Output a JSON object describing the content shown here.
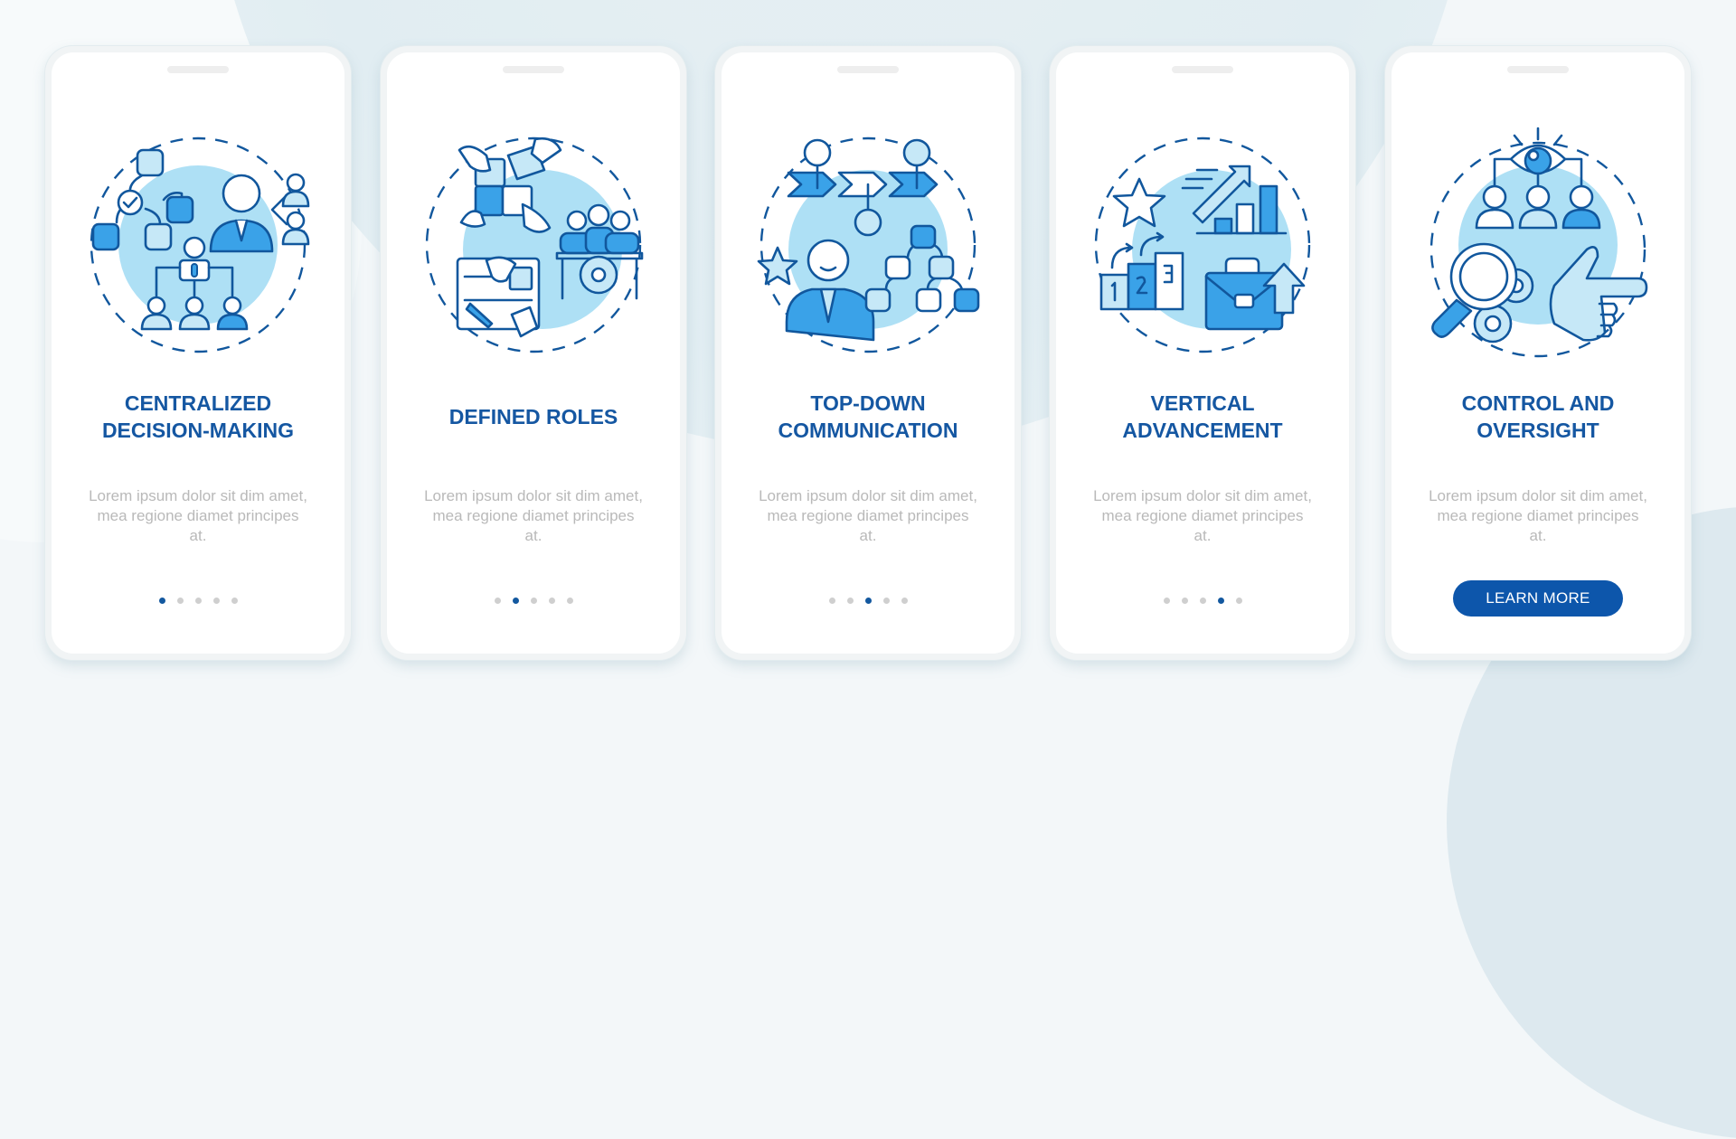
{
  "colors": {
    "background": "#f3f7f9",
    "title": "#1557a2",
    "body_text": "#b9b9b9",
    "dot_active": "#13589f",
    "dot_inactive": "#cfcfcf",
    "button_bg": "#0d56ab",
    "icon_outline": "#11579d",
    "icon_mid_fill": "#3aa2e8",
    "icon_light_fill": "#c6e8f7",
    "icon_bg_circle": "#aee0f5"
  },
  "screens": [
    {
      "icon": "centralized-decision-making-icon",
      "title_lines": [
        "CENTRALIZED",
        "DECISION-MAKING"
      ],
      "body": "Lorem ipsum dolor sit dim amet, mea regione diamet principes at.",
      "page_index": 1,
      "page_count": 5
    },
    {
      "icon": "defined-roles-icon",
      "title_lines": [
        "DEFINED ROLES"
      ],
      "body": "Lorem ipsum dolor sit dim amet, mea regione diamet principes at.",
      "page_index": 2,
      "page_count": 5
    },
    {
      "icon": "top-down-communication-icon",
      "title_lines": [
        "TOP-DOWN",
        "COMMUNICATION"
      ],
      "body": "Lorem ipsum dolor sit dim amet, mea regione diamet principes at.",
      "page_index": 3,
      "page_count": 5
    },
    {
      "icon": "vertical-advancement-icon",
      "title_lines": [
        "VERTICAL",
        "ADVANCEMENT"
      ],
      "body": "Lorem ipsum dolor sit dim amet, mea regione diamet principes at.",
      "page_index": 4,
      "page_count": 5
    },
    {
      "icon": "control-and-oversight-icon",
      "title_lines": [
        "CONTROL AND",
        "OVERSIGHT"
      ],
      "body": "Lorem ipsum dolor sit dim amet, mea regione diamet principes at.",
      "button_label": "LEARN MORE"
    }
  ]
}
